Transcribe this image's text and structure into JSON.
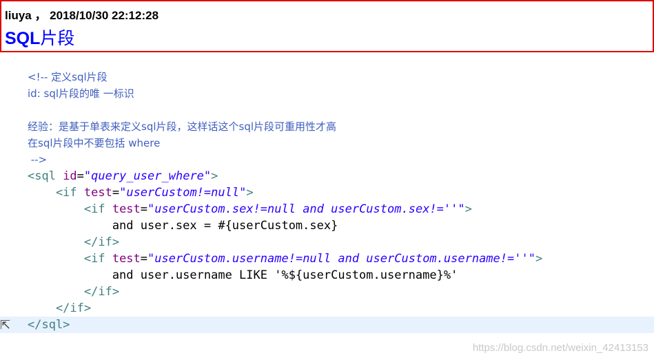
{
  "header": {
    "meta": "liuya ， 2018/10/30 22:12:28",
    "title_latin": "SQL",
    "title_cjk": "片段"
  },
  "code_lines": [
    {
      "parts": [
        {
          "t": "<!-- 定义sql片段",
          "c": "comment"
        }
      ]
    },
    {
      "parts": [
        {
          "t": "id: sql片段的唯 一标识",
          "c": "comment"
        }
      ]
    },
    {
      "parts": [
        {
          "t": "",
          "c": "comment"
        }
      ]
    },
    {
      "parts": [
        {
          "t": "经验：是基于单表来定义sql片段，这样话这个sql片段可重用性才高",
          "c": "comment"
        }
      ]
    },
    {
      "parts": [
        {
          "t": "在sql片段中不要包括 where",
          "c": "comment"
        }
      ]
    },
    {
      "parts": [
        {
          "t": " -->",
          "c": "comment"
        }
      ]
    },
    {
      "parts": [
        {
          "t": "<sql ",
          "c": "tag"
        },
        {
          "t": "id",
          "c": "attr"
        },
        {
          "t": "=",
          "c": "text"
        },
        {
          "t": "\"query_user_where\"",
          "c": "val"
        },
        {
          "t": ">",
          "c": "tag"
        }
      ]
    },
    {
      "parts": [
        {
          "t": "    <if ",
          "c": "tag"
        },
        {
          "t": "test",
          "c": "attr"
        },
        {
          "t": "=",
          "c": "text"
        },
        {
          "t": "\"userCustom!=null\"",
          "c": "val"
        },
        {
          "t": ">",
          "c": "tag"
        }
      ]
    },
    {
      "parts": [
        {
          "t": "        <if ",
          "c": "tag"
        },
        {
          "t": "test",
          "c": "attr"
        },
        {
          "t": "=",
          "c": "text"
        },
        {
          "t": "\"userCustom.sex!=null and userCustom.sex!=''\"",
          "c": "val"
        },
        {
          "t": ">",
          "c": "tag"
        }
      ]
    },
    {
      "parts": [
        {
          "t": "            and user.sex = #{userCustom.sex}",
          "c": "text"
        }
      ]
    },
    {
      "parts": [
        {
          "t": "        </if>",
          "c": "tag"
        }
      ]
    },
    {
      "parts": [
        {
          "t": "        <if ",
          "c": "tag"
        },
        {
          "t": "test",
          "c": "attr"
        },
        {
          "t": "=",
          "c": "text"
        },
        {
          "t": "\"userCustom.username!=null and userCustom.username!=''\"",
          "c": "val"
        },
        {
          "t": ">",
          "c": "tag"
        }
      ]
    },
    {
      "parts": [
        {
          "t": "            and user.username LIKE '%${userCustom.username}%'",
          "c": "text"
        }
      ]
    },
    {
      "parts": [
        {
          "t": "        </if>",
          "c": "tag"
        }
      ]
    },
    {
      "parts": [
        {
          "t": "    </if>",
          "c": "tag"
        }
      ]
    },
    {
      "parts": [
        {
          "t": "</sql>",
          "c": "tag"
        }
      ]
    }
  ],
  "watermark": "https://blog.csdn.net/weixin_42413153",
  "colors": {
    "border": "#e00000",
    "title": "#0000ff",
    "comment": "#3f5fbf",
    "tag": "#3f7f7f",
    "attr": "#7f007f",
    "value": "#2a00ff",
    "current_line": "#e8f2fe"
  },
  "icons": {
    "cursor": "mouse-pointer-icon"
  }
}
